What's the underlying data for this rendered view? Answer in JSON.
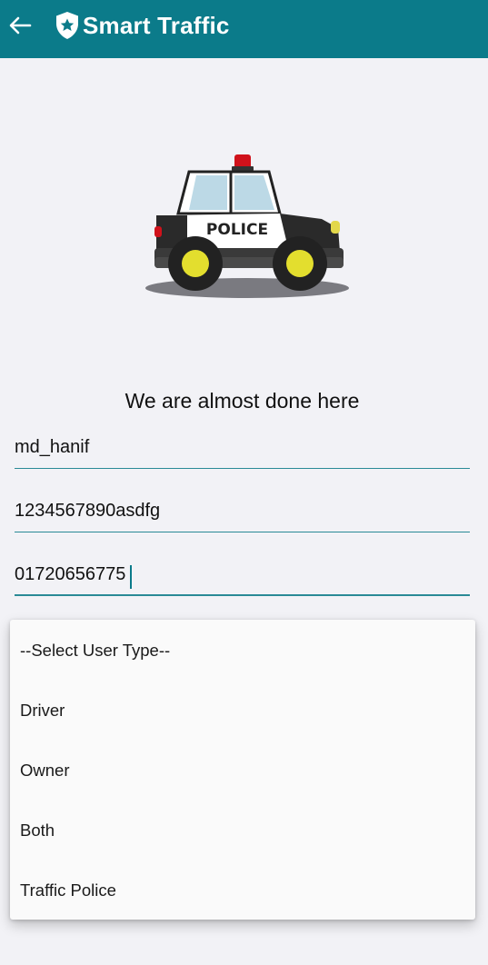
{
  "appbar": {
    "title": "Smart Traffic",
    "back_icon": "arrow-left-icon",
    "brand_icon": "shield-star-icon",
    "background": "#0b7b8a"
  },
  "illustration": {
    "label": "POLICE",
    "icon": "police-car-illustration"
  },
  "form": {
    "heading": "We are almost done here",
    "username": "md_hanif",
    "password": "1234567890asdfg",
    "phone": "01720656775"
  },
  "user_type_dropdown": {
    "options": [
      "--Select User Type--",
      "Driver",
      "Owner",
      "Both",
      "Traffic Police"
    ]
  }
}
